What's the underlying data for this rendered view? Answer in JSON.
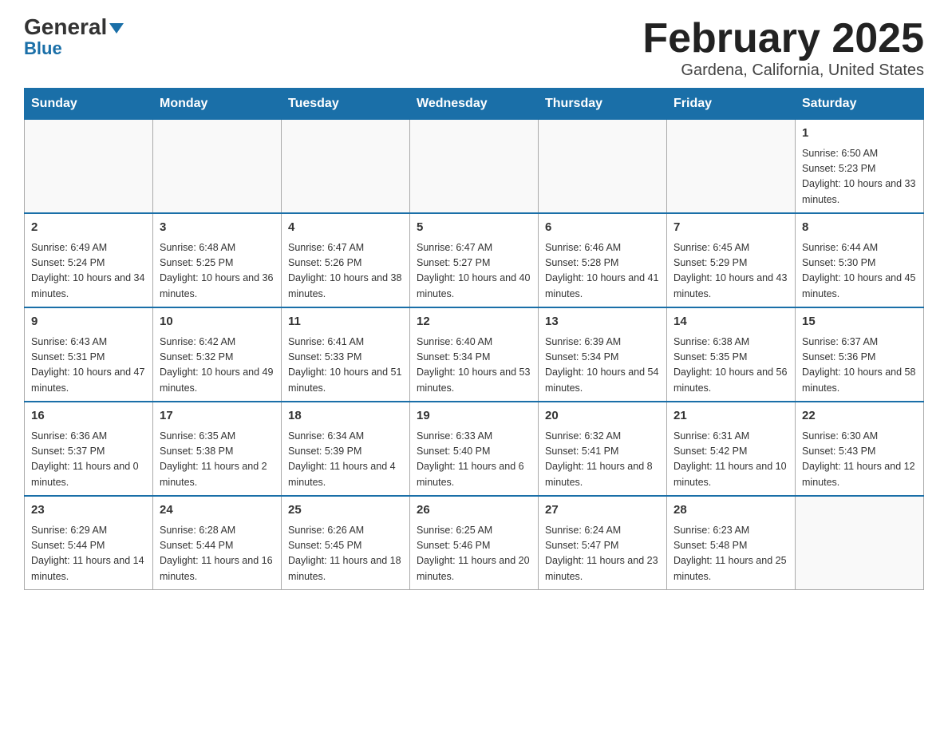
{
  "logo": {
    "general": "General",
    "blue": "Blue"
  },
  "title": "February 2025",
  "subtitle": "Gardena, California, United States",
  "days_of_week": [
    "Sunday",
    "Monday",
    "Tuesday",
    "Wednesday",
    "Thursday",
    "Friday",
    "Saturday"
  ],
  "weeks": [
    [
      {
        "day": "",
        "info": ""
      },
      {
        "day": "",
        "info": ""
      },
      {
        "day": "",
        "info": ""
      },
      {
        "day": "",
        "info": ""
      },
      {
        "day": "",
        "info": ""
      },
      {
        "day": "",
        "info": ""
      },
      {
        "day": "1",
        "info": "Sunrise: 6:50 AM\nSunset: 5:23 PM\nDaylight: 10 hours and 33 minutes."
      }
    ],
    [
      {
        "day": "2",
        "info": "Sunrise: 6:49 AM\nSunset: 5:24 PM\nDaylight: 10 hours and 34 minutes."
      },
      {
        "day": "3",
        "info": "Sunrise: 6:48 AM\nSunset: 5:25 PM\nDaylight: 10 hours and 36 minutes."
      },
      {
        "day": "4",
        "info": "Sunrise: 6:47 AM\nSunset: 5:26 PM\nDaylight: 10 hours and 38 minutes."
      },
      {
        "day": "5",
        "info": "Sunrise: 6:47 AM\nSunset: 5:27 PM\nDaylight: 10 hours and 40 minutes."
      },
      {
        "day": "6",
        "info": "Sunrise: 6:46 AM\nSunset: 5:28 PM\nDaylight: 10 hours and 41 minutes."
      },
      {
        "day": "7",
        "info": "Sunrise: 6:45 AM\nSunset: 5:29 PM\nDaylight: 10 hours and 43 minutes."
      },
      {
        "day": "8",
        "info": "Sunrise: 6:44 AM\nSunset: 5:30 PM\nDaylight: 10 hours and 45 minutes."
      }
    ],
    [
      {
        "day": "9",
        "info": "Sunrise: 6:43 AM\nSunset: 5:31 PM\nDaylight: 10 hours and 47 minutes."
      },
      {
        "day": "10",
        "info": "Sunrise: 6:42 AM\nSunset: 5:32 PM\nDaylight: 10 hours and 49 minutes."
      },
      {
        "day": "11",
        "info": "Sunrise: 6:41 AM\nSunset: 5:33 PM\nDaylight: 10 hours and 51 minutes."
      },
      {
        "day": "12",
        "info": "Sunrise: 6:40 AM\nSunset: 5:34 PM\nDaylight: 10 hours and 53 minutes."
      },
      {
        "day": "13",
        "info": "Sunrise: 6:39 AM\nSunset: 5:34 PM\nDaylight: 10 hours and 54 minutes."
      },
      {
        "day": "14",
        "info": "Sunrise: 6:38 AM\nSunset: 5:35 PM\nDaylight: 10 hours and 56 minutes."
      },
      {
        "day": "15",
        "info": "Sunrise: 6:37 AM\nSunset: 5:36 PM\nDaylight: 10 hours and 58 minutes."
      }
    ],
    [
      {
        "day": "16",
        "info": "Sunrise: 6:36 AM\nSunset: 5:37 PM\nDaylight: 11 hours and 0 minutes."
      },
      {
        "day": "17",
        "info": "Sunrise: 6:35 AM\nSunset: 5:38 PM\nDaylight: 11 hours and 2 minutes."
      },
      {
        "day": "18",
        "info": "Sunrise: 6:34 AM\nSunset: 5:39 PM\nDaylight: 11 hours and 4 minutes."
      },
      {
        "day": "19",
        "info": "Sunrise: 6:33 AM\nSunset: 5:40 PM\nDaylight: 11 hours and 6 minutes."
      },
      {
        "day": "20",
        "info": "Sunrise: 6:32 AM\nSunset: 5:41 PM\nDaylight: 11 hours and 8 minutes."
      },
      {
        "day": "21",
        "info": "Sunrise: 6:31 AM\nSunset: 5:42 PM\nDaylight: 11 hours and 10 minutes."
      },
      {
        "day": "22",
        "info": "Sunrise: 6:30 AM\nSunset: 5:43 PM\nDaylight: 11 hours and 12 minutes."
      }
    ],
    [
      {
        "day": "23",
        "info": "Sunrise: 6:29 AM\nSunset: 5:44 PM\nDaylight: 11 hours and 14 minutes."
      },
      {
        "day": "24",
        "info": "Sunrise: 6:28 AM\nSunset: 5:44 PM\nDaylight: 11 hours and 16 minutes."
      },
      {
        "day": "25",
        "info": "Sunrise: 6:26 AM\nSunset: 5:45 PM\nDaylight: 11 hours and 18 minutes."
      },
      {
        "day": "26",
        "info": "Sunrise: 6:25 AM\nSunset: 5:46 PM\nDaylight: 11 hours and 20 minutes."
      },
      {
        "day": "27",
        "info": "Sunrise: 6:24 AM\nSunset: 5:47 PM\nDaylight: 11 hours and 23 minutes."
      },
      {
        "day": "28",
        "info": "Sunrise: 6:23 AM\nSunset: 5:48 PM\nDaylight: 11 hours and 25 minutes."
      },
      {
        "day": "",
        "info": ""
      }
    ]
  ]
}
